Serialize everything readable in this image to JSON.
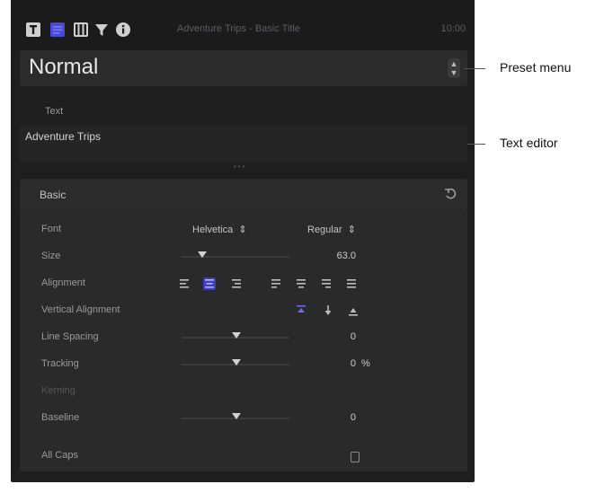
{
  "inspector": {
    "tabs": [
      {
        "name": "title-inspector",
        "icon": "title-icon",
        "active": true
      },
      {
        "name": "text-inspector",
        "icon": "text-icon",
        "active": false
      },
      {
        "name": "video-inspector",
        "icon": "film-icon",
        "active": false
      },
      {
        "name": "filter-inspector",
        "icon": "filter-icon",
        "active": false
      },
      {
        "name": "info-inspector",
        "icon": "info-icon",
        "active": false
      }
    ],
    "title": "Adventure Trips - Basic Title",
    "duration": "10:00"
  },
  "preset": {
    "value": "Normal"
  },
  "text": {
    "label": "Text",
    "value": "Adventure Trips"
  },
  "basic": {
    "label": "Basic",
    "font": {
      "label": "Font",
      "family": "Helvetica",
      "style": "Regular"
    },
    "size": {
      "label": "Size",
      "value": "63.0"
    },
    "alignment": {
      "label": "Alignment"
    },
    "vertical_alignment": {
      "label": "Vertical Alignment"
    },
    "line_spacing": {
      "label": "Line Spacing",
      "value": "0"
    },
    "tracking": {
      "label": "Tracking",
      "value": "0",
      "unit": "%"
    },
    "kerning": {
      "label": "Kerning"
    },
    "baseline": {
      "label": "Baseline",
      "value": "0"
    },
    "all_caps": {
      "label": "All Caps",
      "checked": false
    }
  },
  "callouts": {
    "preset_menu": "Preset menu",
    "text_editor": "Text editor"
  },
  "colors": {
    "panel_bg": "#1e1e1e",
    "accent": "#4a4ad8",
    "text_primary": "#e8e8e8",
    "text_secondary": "#9a9a9a"
  }
}
